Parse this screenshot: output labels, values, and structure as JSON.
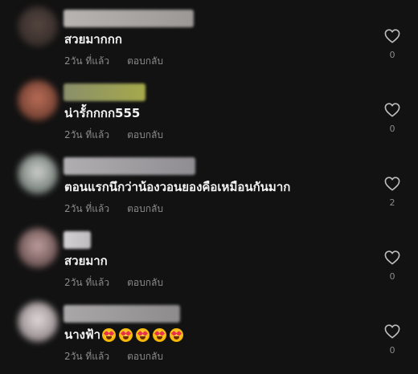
{
  "comments": [
    {
      "text": "สวยมากกก",
      "time": "2วัน ที่แล้ว",
      "reply_label": "ตอบกลับ",
      "likes": "0",
      "avatar_colors": [
        "#5a4a44",
        "#2a2321"
      ],
      "username_colors": [
        "#b8b4b2",
        "#9c9896"
      ],
      "has_emojis": false
    },
    {
      "text": "น่ารั้กกกก555",
      "time": "2วัน ที่แล้ว",
      "reply_label": "ตอบกลับ",
      "likes": "0",
      "avatar_colors": [
        "#c4735c",
        "#5b3023"
      ],
      "username_colors": [
        "#8a8f6a",
        "#a5a94b"
      ],
      "has_emojis": false
    },
    {
      "text": "ตอนแรกนึกว่าน้องวอนยองคือเหมือนกันมาก",
      "time": "2วัน ที่แล้ว",
      "reply_label": "ตอบกลับ",
      "likes": "2",
      "avatar_colors": [
        "#d9dcd9",
        "#4e5a54"
      ],
      "username_colors": [
        "#b0aeb0",
        "#8f8d91"
      ],
      "has_emojis": false
    },
    {
      "text": "สวยมาก",
      "time": "2วัน ที่แล้ว",
      "reply_label": "ตอบกลับ",
      "likes": "0",
      "avatar_colors": [
        "#c9a7a6",
        "#4b3434"
      ],
      "username_colors": [
        "#d2d0d2",
        "#bdbbbd"
      ],
      "has_emojis": false
    },
    {
      "text": "นางฟ้า",
      "time": "2วัน ที่แล้ว",
      "reply_label": "ตอบกลับ",
      "likes": "0",
      "avatar_colors": [
        "#ece5e6",
        "#7a6e70"
      ],
      "username_colors": [
        "#a9a7a8",
        "#8d8b8c"
      ],
      "has_emojis": true,
      "emoji_count": 5
    }
  ],
  "icons": {
    "like": "heart-outline-icon",
    "emoji": "smiling-face-with-heart-eyes"
  }
}
